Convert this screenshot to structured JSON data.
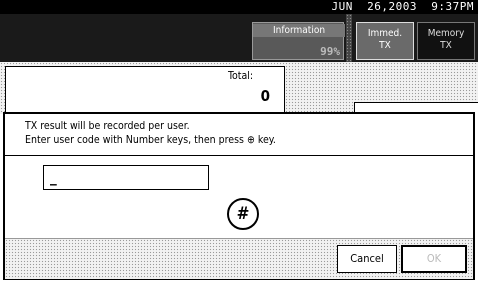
{
  "status": {
    "datetime": "JUN  26,2003  9:37PM"
  },
  "header": {
    "information_label": "Information",
    "memory_percent": "99%",
    "immed_tx_line1": "Immed.",
    "immed_tx_line2": "TX",
    "memory_tx_line1": "Memory",
    "memory_tx_line2": "TX"
  },
  "total": {
    "label": "Total:",
    "value": "0"
  },
  "dialog": {
    "message_line1": "TX result will be recorded per user.",
    "message_line2": "Enter user code with Number keys, then press ⊕ key.",
    "user_code_value": "_",
    "hash_key_symbol": "#",
    "cancel_label": "Cancel",
    "ok_label": "OK"
  }
}
